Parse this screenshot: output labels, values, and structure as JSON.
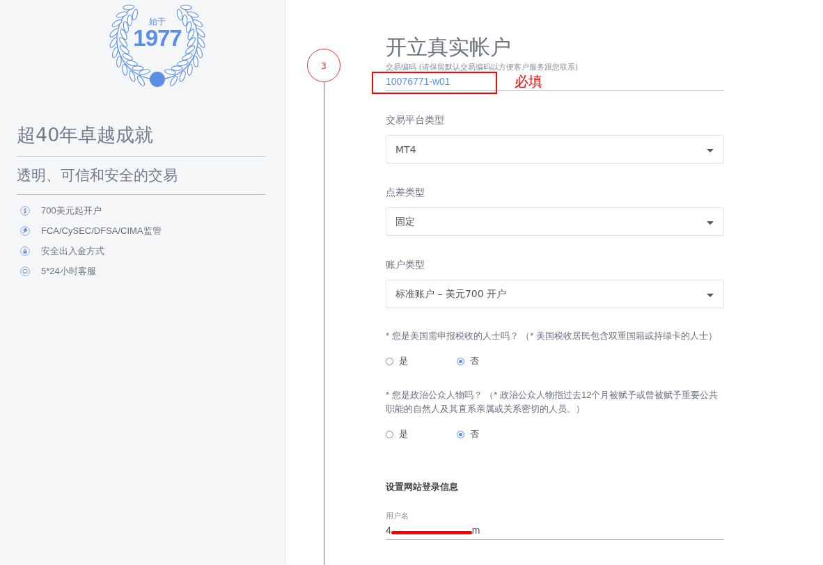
{
  "sidebar": {
    "badge": {
      "caption": "始于",
      "year": "1977"
    },
    "title": "超40年卓越成就",
    "subtitle": "透明、可信和安全的交易",
    "features": [
      {
        "kind": "dollar",
        "text": "700美元起开户"
      },
      {
        "kind": "gavel",
        "text": "FCA/CySEC/DFSA/CIMA监管"
      },
      {
        "kind": "lock",
        "text": "安全出入金方式"
      },
      {
        "kind": "chat",
        "text": "5*24小时客服"
      }
    ]
  },
  "form": {
    "step": "3",
    "title": "开立真实帐户",
    "fields": [
      {
        "kind": "text",
        "label": "交易编码 (请保留默认交易编码以方便客户服务跟您联系)",
        "value": "10076771-w01",
        "annotation": "必填"
      },
      {
        "kind": "select",
        "label": "交易平台类型",
        "value": "MT4"
      },
      {
        "kind": "select",
        "label": "点差类型",
        "value": "固定"
      },
      {
        "kind": "select",
        "label": "账户类型",
        "value": "标准账户 – 美元700 开户"
      },
      {
        "kind": "radio",
        "label": "* 您是美国需申报税收的人士吗？ （* 美国税收居民包含双重国籍或持绿卡的人士）",
        "options": [
          {
            "text": "是",
            "selected": false
          },
          {
            "text": "否",
            "selected": true
          }
        ]
      },
      {
        "kind": "radio",
        "label": "* 您是政治公众人物吗？  （* 政治公众人物指过去12个月被赋予或曾被赋予重要公共职能的自然人及其直系亲属或关系密切的人员。）",
        "options": [
          {
            "text": "是",
            "selected": false
          },
          {
            "text": "否",
            "selected": true
          }
        ]
      },
      {
        "kind": "section",
        "label": "设置网站登录信息"
      },
      {
        "kind": "text",
        "label": "用户名",
        "value": "4",
        "value_end": "m",
        "redacted": true
      }
    ]
  }
}
